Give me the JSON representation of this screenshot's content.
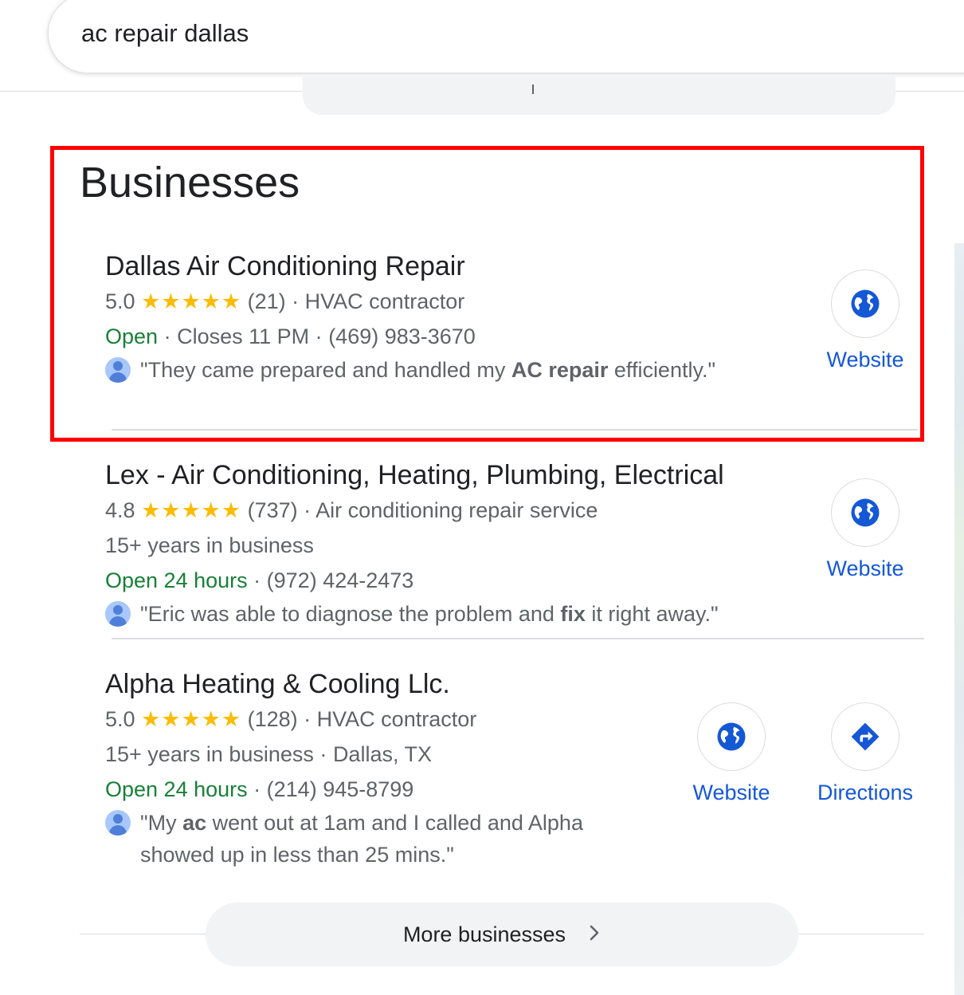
{
  "search": {
    "query": "ac repair dallas"
  },
  "section": {
    "title": "Businesses"
  },
  "businesses": [
    {
      "name": "Dallas Air Conditioning Repair",
      "rating": "5.0",
      "stars": "★★★★★",
      "reviews": "(21)",
      "category": "HVAC contractor",
      "years": "",
      "location": "",
      "status": "Open",
      "hours": "Closes 11 PM",
      "phone": "(469) 983-3670",
      "quote_pre": "\"They came prepared and handled my ",
      "quote_bold": "AC repair",
      "quote_post": " efficiently.\"",
      "actions": [
        "Website"
      ]
    },
    {
      "name": "Lex - Air Conditioning, Heating, Plumbing, Electrical",
      "rating": "4.8",
      "stars": "★★★★★",
      "reviews": "(737)",
      "category": "Air conditioning repair service",
      "years": "15+ years in business",
      "location": "",
      "status": "Open 24 hours",
      "hours": "",
      "phone": "(972) 424-2473",
      "quote_pre": "\"Eric was able to diagnose the problem and ",
      "quote_bold": "fix",
      "quote_post": " it right away.\"",
      "actions": [
        "Website"
      ]
    },
    {
      "name": "Alpha Heating & Cooling Llc.",
      "rating": "5.0",
      "stars": "★★★★★",
      "reviews": "(128)",
      "category": "HVAC contractor",
      "years": "15+ years in business",
      "location": "Dallas, TX",
      "status": "Open 24 hours",
      "hours": "",
      "phone": "(214) 945-8799",
      "quote_pre": "\"My ",
      "quote_bold": "ac",
      "quote_post": " went out at 1am and I called and Alpha",
      "quote_line2": "showed up in less than 25 mins.\"",
      "actions": [
        "Website",
        "Directions"
      ]
    }
  ],
  "separator": "·",
  "more": {
    "label": "More businesses",
    "chevron": "›"
  },
  "colors": {
    "highlight": "#ff0000",
    "link": "#1558d6",
    "open": "#188038",
    "star": "#fbbc04"
  },
  "icons": {
    "website": "globe-icon",
    "directions": "directions-icon",
    "more": "chevron-right-icon"
  }
}
